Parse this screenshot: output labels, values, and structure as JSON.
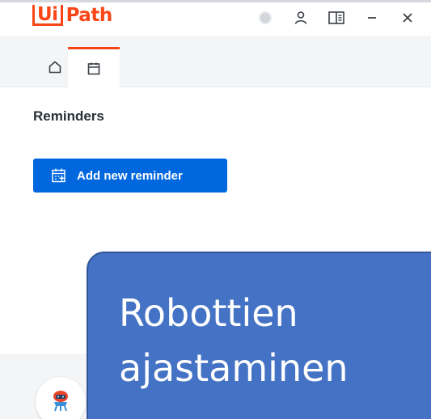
{
  "app": {
    "logo_box_text": "Ui",
    "logo_rest_text": "Path"
  },
  "titlebar": {
    "controls": [
      {
        "icon": "status-dot-icon"
      },
      {
        "icon": "user-icon"
      },
      {
        "icon": "panel-layout-icon"
      },
      {
        "icon": "minimize-icon"
      },
      {
        "icon": "close-icon"
      }
    ]
  },
  "tabs": [
    {
      "icon": "home-icon",
      "active": false
    },
    {
      "icon": "calendar-icon",
      "active": true
    }
  ],
  "main": {
    "section_title": "Reminders",
    "add_button_label": "Add new reminder",
    "add_button_icon": "calendar-add-icon"
  },
  "overlay": {
    "line1": "Robottien",
    "line2": "ajastaminen"
  },
  "colors": {
    "brand": "#fa4616",
    "primary_button": "#0067df",
    "overlay_fill": "#4472c4",
    "overlay_border": "#2f5597"
  }
}
